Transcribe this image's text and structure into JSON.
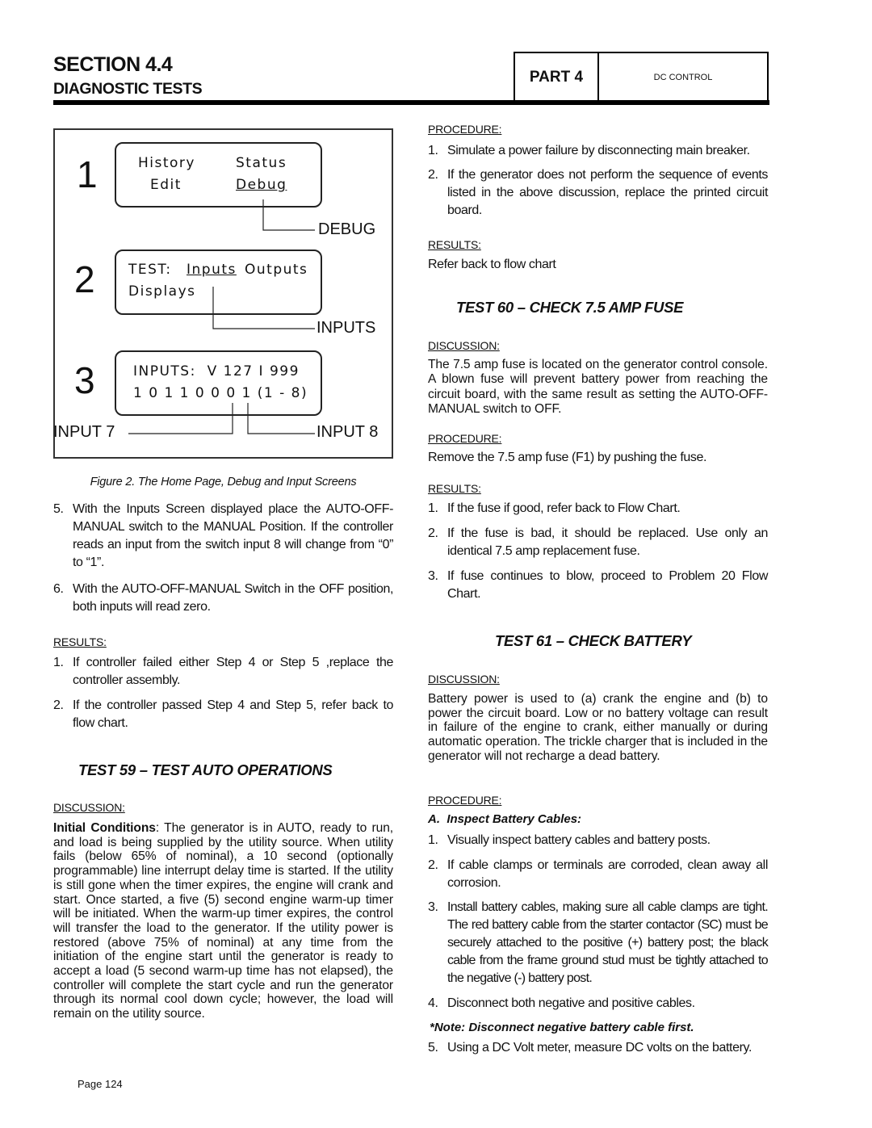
{
  "header": {
    "section": "SECTION 4.4",
    "subtitle": "DIAGNOSTIC TESTS",
    "part": "PART 4",
    "part_title": "DC CONTROL"
  },
  "figure": {
    "screen1": {
      "number": "1",
      "items": [
        "History",
        "Status",
        "Edit",
        "Debug"
      ],
      "callout": "DEBUG"
    },
    "screen2": {
      "number": "2",
      "line1_prefix": "TEST:",
      "line1_inputs": "Inputs",
      "line1_outputs": "Outputs",
      "line2": "Displays",
      "callout": "INPUTS"
    },
    "screen3": {
      "number": "3",
      "line1": "INPUTS:  V 127 I 999",
      "line2": "1 0 1 1 0 0 0 1 (1 - 8)",
      "callout_left": "INPUT 7",
      "callout_right": "INPUT 8"
    },
    "caption": "Figure 2. The Home Page, Debug and Input Screens"
  },
  "left": {
    "steps": [
      {
        "n": "5.",
        "text": "With the Inputs Screen displayed place the AUTO-OFF-MANUAL switch to the MANUAL Position. If the controller reads an input from the switch input 8 will change from “0” to “1”."
      },
      {
        "n": "6.",
        "text": "With the AUTO-OFF-MANUAL Switch in the OFF position, both inputs will read zero."
      }
    ],
    "results_label": "RESULTS:",
    "results": [
      {
        "n": "1.",
        "text": "If controller failed either Step 4 or Step 5 ,replace the controller assembly."
      },
      {
        "n": "2.",
        "text": "If the controller passed Step 4 and Step 5, refer back to flow chart."
      }
    ],
    "test59": {
      "heading": "TEST 59 – TEST AUTO OPERATIONS",
      "discussion_label": "DISCUSSION:",
      "initial_label": "Initial Conditions",
      "text": ": The generator is in AUTO, ready to run, and load is being supplied by the utility source. When utility fails (below 65% of nominal), a 10 second (optionally programmable) line interrupt delay time is started. If the utility is still gone when the timer expires, the engine will crank and start. Once started, a five (5) second engine warm-up timer will be initiated. When the warm-up timer expires, the control will transfer the load to the generator. If the utility power is restored (above 75% of nominal) at any time from the initiation of the engine start until the generator is ready to accept a load (5 second warm-up time has not elapsed), the controller will complete the start cycle and run the generator through its normal cool down cycle; however, the load will remain on the utility source."
    }
  },
  "right": {
    "procedure_label": "PROCEDURE:",
    "procedure": [
      {
        "n": "1.",
        "text": "Simulate a power failure by disconnecting main breaker."
      },
      {
        "n": "2.",
        "text": "If the generator does not perform the sequence of events listed in the above discussion, replace the printed circuit board."
      }
    ],
    "results_label": "RESULTS:",
    "results_text": "Refer back to flow chart",
    "test60": {
      "heading": "TEST 60 – CHECK 7.5 AMP FUSE",
      "discussion_label": "DISCUSSION:",
      "discussion": "The 7.5 amp fuse is located on the generator control console. A blown fuse will prevent battery power from reaching the circuit board, with the same result as setting the AUTO-OFF-MANUAL switch to OFF.",
      "procedure_label": "PROCEDURE:",
      "procedure": "Remove the 7.5 amp fuse (F1) by pushing the fuse.",
      "results_label": "RESULTS:",
      "results": [
        {
          "n": "1.",
          "text": "If the fuse if good, refer back to Flow Chart."
        },
        {
          "n": "2.",
          "text": "If the fuse is bad, it should be replaced. Use only an identical 7.5 amp replacement fuse."
        },
        {
          "n": "3.",
          "text": "If fuse continues to blow, proceed to Problem 20 Flow Chart."
        }
      ]
    },
    "test61": {
      "heading": "TEST 61 – CHECK BATTERY",
      "discussion_label": "DISCUSSION:",
      "discussion": "Battery power is used to (a) crank the engine and (b) to power the circuit board. Low or no battery voltage can result in failure of the engine to crank, either manually or during automatic operation. The trickle charger that is included in the generator will not recharge a dead battery.",
      "procedure_label": "PROCEDURE:",
      "subheading": "A.  Inspect Battery Cables:",
      "steps": [
        {
          "n": "1.",
          "text": "Visually inspect battery cables and battery posts."
        },
        {
          "n": "2.",
          "text": "If cable clamps or terminals are corroded, clean away all corrosion."
        },
        {
          "n": "3.",
          "text": "Install battery cables, making sure all cable clamps are tight. The red battery cable from the starter contactor (SC) must be securely attached to the positive (+) battery post; the black cable from the frame ground stud must be tightly attached to the negative (-) battery post."
        },
        {
          "n": "4.",
          "text": "Disconnect both negative and positive cables."
        }
      ],
      "note": "*Note: Disconnect negative battery cable first.",
      "step5": {
        "n": "5.",
        "text": "Using a DC Volt meter, measure DC volts on the battery."
      }
    }
  },
  "footer": {
    "page": "Page 124"
  }
}
